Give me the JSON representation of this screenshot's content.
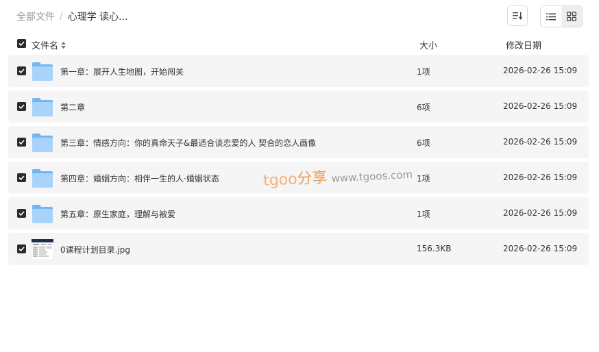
{
  "breadcrumb": {
    "root": "全部文件",
    "separator": "/",
    "current": "心理学 读心..."
  },
  "toolbar": {
    "sort_icon": "sort-icon",
    "list_view_icon": "list-view-icon",
    "grid_view_icon": "grid-view-icon",
    "active_view": "grid"
  },
  "table": {
    "headers": {
      "name": "文件名",
      "size": "大小",
      "date": "修改日期"
    },
    "rows": [
      {
        "type": "folder",
        "name": "第一章：展开人生地图，开始闯关",
        "size": "1项",
        "date": "2026-02-26 15:09"
      },
      {
        "type": "folder",
        "name": "第二章",
        "size": "6项",
        "date": "2026-02-26 15:09"
      },
      {
        "type": "folder",
        "name": "第三章：情感方向：你的真命天子&最适合谈恋爱的人 契合的恋人画像",
        "size": "6项",
        "date": "2026-02-26 15:09"
      },
      {
        "type": "folder",
        "name": "第四章：婚姻方向：相伴一生的人·婚姻状态",
        "size": "1项",
        "date": "2026-02-26 15:09"
      },
      {
        "type": "folder",
        "name": "第五章：原生家庭，理解与被爱",
        "size": "1项",
        "date": "2026-02-26 15:09"
      },
      {
        "type": "image",
        "name": "0课程计划目录.jpg",
        "size": "156.3KB",
        "date": "2026-02-26 15:09"
      }
    ]
  },
  "watermark": {
    "brand": "tgoo",
    "cn": "分享",
    "url": "www.tgoos.com"
  },
  "colors": {
    "row_bg": "#f5f5f5",
    "checkbox": "#2b2b2b",
    "folder_light": "#a8d4fb",
    "folder_dark": "#72b6f5",
    "watermark_orange": "#f2b27a"
  }
}
